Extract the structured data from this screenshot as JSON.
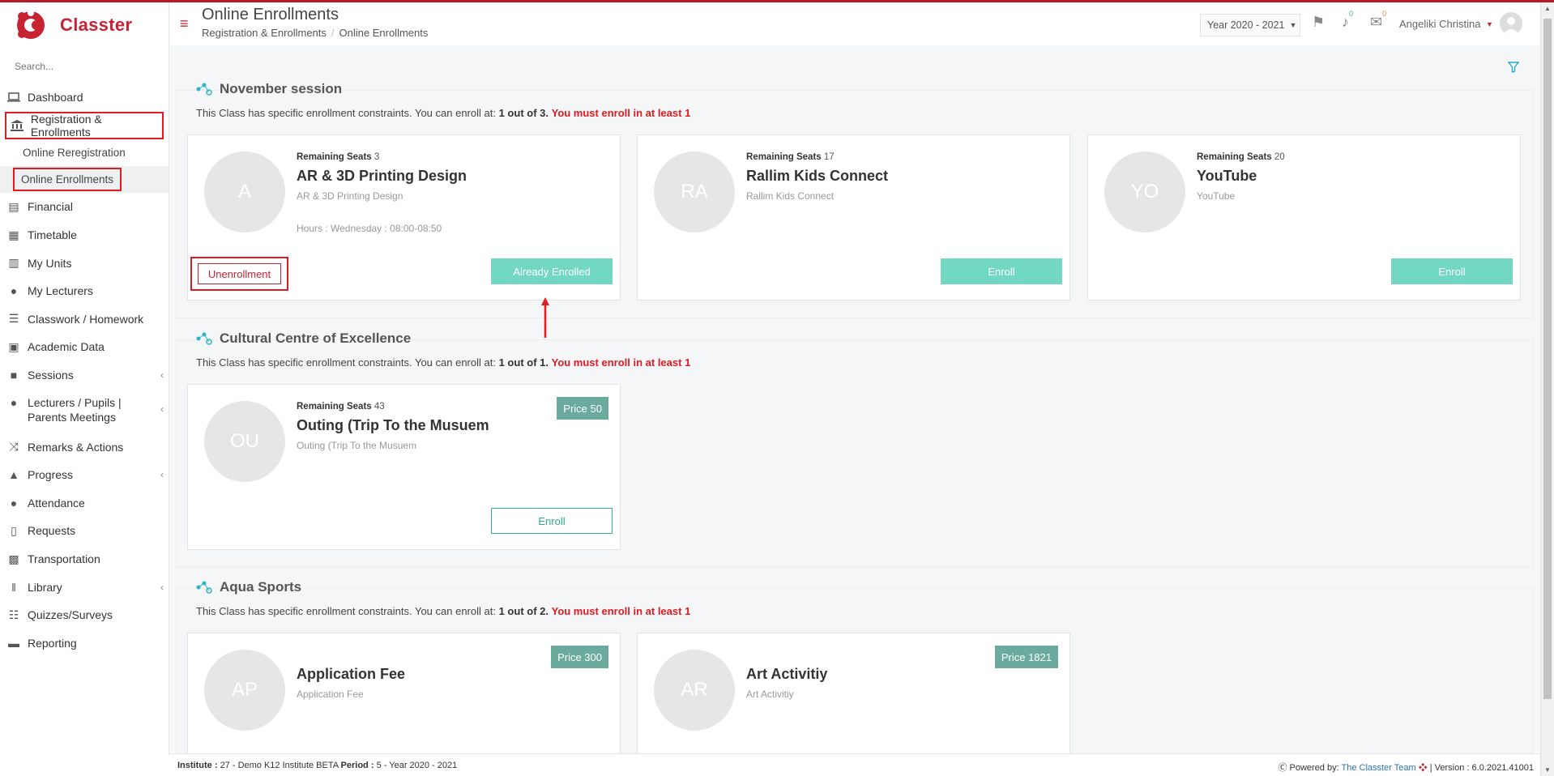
{
  "app": {
    "name": "Classter",
    "brand_color": "#c62333",
    "accent_color": "#72d8c4"
  },
  "search": {
    "placeholder": "Search..."
  },
  "sidebar": {
    "items": [
      {
        "label": "Dashboard",
        "icon": "laptop-icon"
      },
      {
        "label": "Registration & Enrollments",
        "icon": "institution-icon"
      },
      {
        "label": "Financial",
        "icon": "coins-icon"
      },
      {
        "label": "Timetable",
        "icon": "calendar-icon"
      },
      {
        "label": "My Units",
        "icon": "book-icon"
      },
      {
        "label": "My Lecturers",
        "icon": "users-icon"
      },
      {
        "label": "Classwork / Homework",
        "icon": "list-icon"
      },
      {
        "label": "Academic Data",
        "icon": "chart-icon"
      },
      {
        "label": "Sessions",
        "icon": "sessions-icon"
      },
      {
        "label": "Lecturers / Pupils | Parents Meetings",
        "icon": "meeting-icon"
      },
      {
        "label": "Remarks & Actions",
        "icon": "shuffle-icon"
      },
      {
        "label": "Progress",
        "icon": "graduation-cap-icon"
      },
      {
        "label": "Attendance",
        "icon": "user-check-icon"
      },
      {
        "label": "Requests",
        "icon": "document-icon"
      },
      {
        "label": "Transportation",
        "icon": "bus-icon"
      },
      {
        "label": "Library",
        "icon": "books-icon"
      },
      {
        "label": "Quizzes/Surveys",
        "icon": "checklist-icon"
      },
      {
        "label": "Reporting",
        "icon": "printer-icon"
      }
    ],
    "sub_items": [
      {
        "label": "Online Reregistration"
      },
      {
        "label": "Online Enrollments"
      }
    ]
  },
  "header": {
    "title": "Online Enrollments",
    "breadcrumb": [
      "Registration & Enrollments",
      "Online Enrollments"
    ],
    "year": "Year 2020 - 2021",
    "notifications_count": "0",
    "messages_count": "0",
    "user_name": "Angeliki Christina"
  },
  "sections": [
    {
      "title": "November session",
      "constraint_text": "This Class has specific enrollment constraints. You can enroll at:",
      "constraint_count": "1 out of 3.",
      "constraint_warning": "You must enroll in at least 1",
      "cards": [
        {
          "initials": "A",
          "seats_label": "Remaining Seats",
          "seats": "3",
          "title": "AR & 3D Printing Design",
          "subtitle": "AR & 3D Printing Design",
          "hours": "Hours : Wednesday : 08:00-08:50",
          "unenroll_label": "Unenrollment",
          "button_label": "Already Enrolled"
        },
        {
          "initials": "RA",
          "seats_label": "Remaining Seats",
          "seats": "17",
          "title": "Rallim Kids Connect",
          "subtitle": "Rallim Kids Connect",
          "button_label": "Enroll"
        },
        {
          "initials": "YO",
          "seats_label": "Remaining Seats",
          "seats": "20",
          "title": "YouTube",
          "subtitle": "YouTube",
          "button_label": "Enroll"
        }
      ]
    },
    {
      "title": "Cultural Centre of Excellence",
      "constraint_text": "This Class has specific enrollment constraints. You can enroll at:",
      "constraint_count": "1 out of 1.",
      "constraint_warning": "You must enroll in at least 1",
      "cards": [
        {
          "initials": "OU",
          "seats_label": "Remaining Seats",
          "seats": "43",
          "title": "Outing (Trip To the Musuem",
          "subtitle": "Outing (Trip To the Musuem",
          "price": "Price 50",
          "button_label": "Enroll"
        }
      ]
    },
    {
      "title": "Aqua Sports",
      "constraint_text": "This Class has specific enrollment constraints. You can enroll at:",
      "constraint_count": "1 out of 2.",
      "constraint_warning": "You must enroll in at least 1",
      "cards": [
        {
          "initials": "AP",
          "title": "Application Fee",
          "subtitle": "Application Fee",
          "price": "Price 300"
        },
        {
          "initials": "AR",
          "title": "Art Activitiy",
          "subtitle": "Art Activitiy",
          "price": "Price 1821"
        }
      ]
    }
  ],
  "footer": {
    "institute_label": "Institute :",
    "institute_value": "27 - Demo K12 Institute BETA",
    "period_label": "Period :",
    "period_value": "5 - Year 2020 - 2021",
    "powered_label": "Powered by:",
    "powered_link": "The Classter Team",
    "version": "| Version : 6.0.2021.41001"
  }
}
